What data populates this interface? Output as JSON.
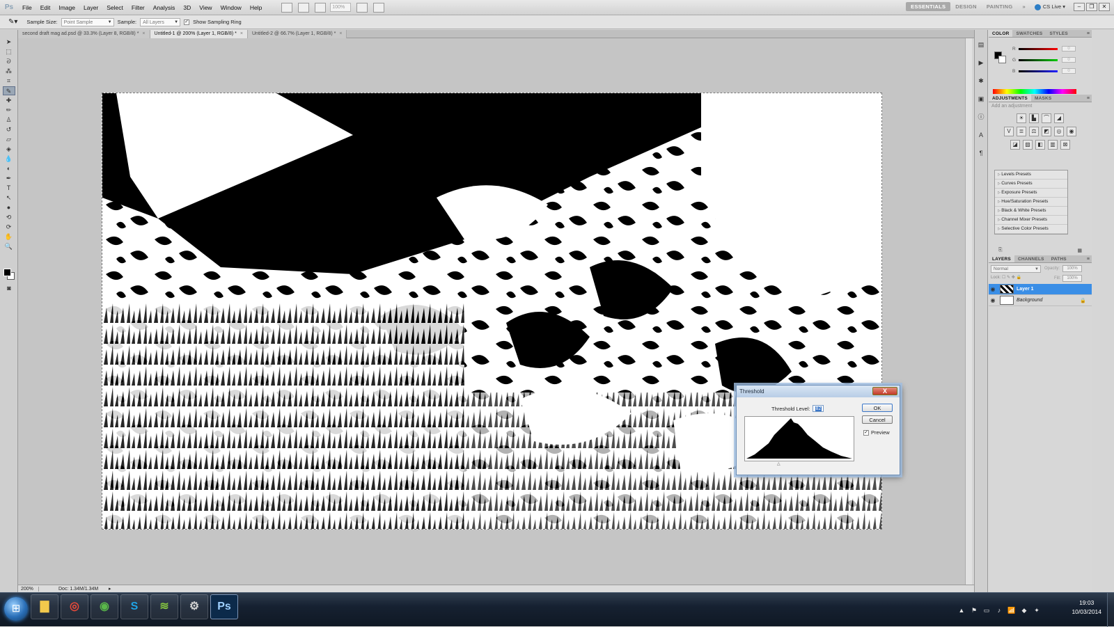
{
  "app": {
    "logo": "Ps",
    "menu": [
      "File",
      "Edit",
      "Image",
      "Layer",
      "Select",
      "Filter",
      "Analysis",
      "3D",
      "View",
      "Window",
      "Help"
    ],
    "zoom_field": "100%",
    "workspaces": [
      "ESSENTIALS",
      "DESIGN",
      "PAINTING"
    ],
    "workspace_more": "»",
    "cs_live": "CS Live"
  },
  "options": {
    "sample_size_label": "Sample Size:",
    "sample_size_value": "Point Sample",
    "sample_label": "Sample:",
    "sample_value": "All Layers",
    "show_ring_label": "Show Sampling Ring",
    "show_ring_checked": "✓"
  },
  "tabs": [
    {
      "label": "second draft mag ad.psd @ 33.3% (Layer 8, RGB/8) *"
    },
    {
      "label": "Untitled-1 @ 200% (Layer 1, RGB/8) *"
    },
    {
      "label": "Untitled-2 @ 66.7% (Layer 1, RGB/8) *"
    }
  ],
  "status": {
    "zoom": "200%",
    "doc": "Doc: 1.34M/1.34M"
  },
  "threshold": {
    "title": "Threshold",
    "close": "X",
    "level_label": "Threshold Level:",
    "level_value": "82",
    "ok": "OK",
    "cancel": "Cancel",
    "preview_label": "Preview",
    "preview_checked": "✓"
  },
  "color_panel": {
    "tabs": [
      "COLOR",
      "SWATCHES",
      "STYLES"
    ],
    "sliders": [
      {
        "letter": "R",
        "value": "0",
        "color": "#d9261c"
      },
      {
        "letter": "G",
        "value": "0",
        "color": "#1fa83a"
      },
      {
        "letter": "B",
        "value": "0",
        "color": "#2642c8"
      }
    ]
  },
  "adjustments": {
    "tabs": [
      "ADJUSTMENTS",
      "MASKS"
    ],
    "hint": "Add an adjustment",
    "presets": [
      "Levels Presets",
      "Curves Presets",
      "Exposure Presets",
      "Hue/Saturation Presets",
      "Black & White Presets",
      "Channel Mixer Presets",
      "Selective Color Presets"
    ]
  },
  "layers": {
    "tabs": [
      "LAYERS",
      "CHANNELS",
      "PATHS"
    ],
    "blend_mode": "Normal",
    "opacity_label": "Opacity:",
    "opacity": "100%",
    "fill_label": "Fill:",
    "fill": "100%",
    "lock_label": "Lock:",
    "items": [
      {
        "name": "Layer 1",
        "selected": true
      },
      {
        "name": "Background",
        "selected": false
      }
    ]
  },
  "taskbar": {
    "clock_time": "19:03",
    "clock_date": "10/03/2014"
  }
}
